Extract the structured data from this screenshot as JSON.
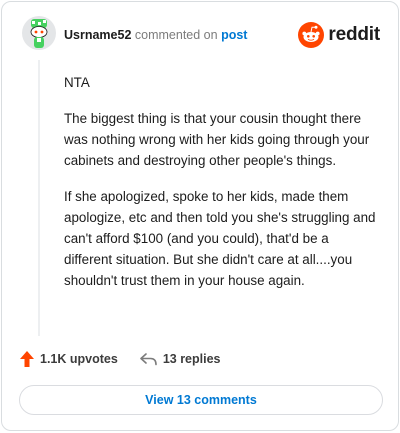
{
  "header": {
    "username": "Usrname52",
    "action_text": "commented on",
    "post_link": "post"
  },
  "brand": {
    "wordmark": "reddit",
    "icon": "reddit-logo-icon",
    "color": "#ff4500"
  },
  "comment": {
    "paragraphs": [
      "NTA",
      "The biggest thing is that your cousin thought there was nothing wrong with her kids going through your cabinets and destroying other people's things.",
      "If she apologized, spoke to her kids, made them apologize, etc and then told you she's struggling and can't afford $100 (and you could), that'd be a different situation. But she didn't care at all....you shouldn't trust them in your house again."
    ]
  },
  "actions": {
    "upvotes": "1.1K upvotes",
    "upvote_icon": "upvote-arrow-icon",
    "replies": "13 replies",
    "reply_icon": "reply-arrow-icon"
  },
  "view_button": {
    "label": "View 13 comments"
  },
  "colors": {
    "accent": "#0079d3",
    "upvote": "#ff4500",
    "text": "#1c1c1c",
    "muted": "#7c7c7c"
  }
}
